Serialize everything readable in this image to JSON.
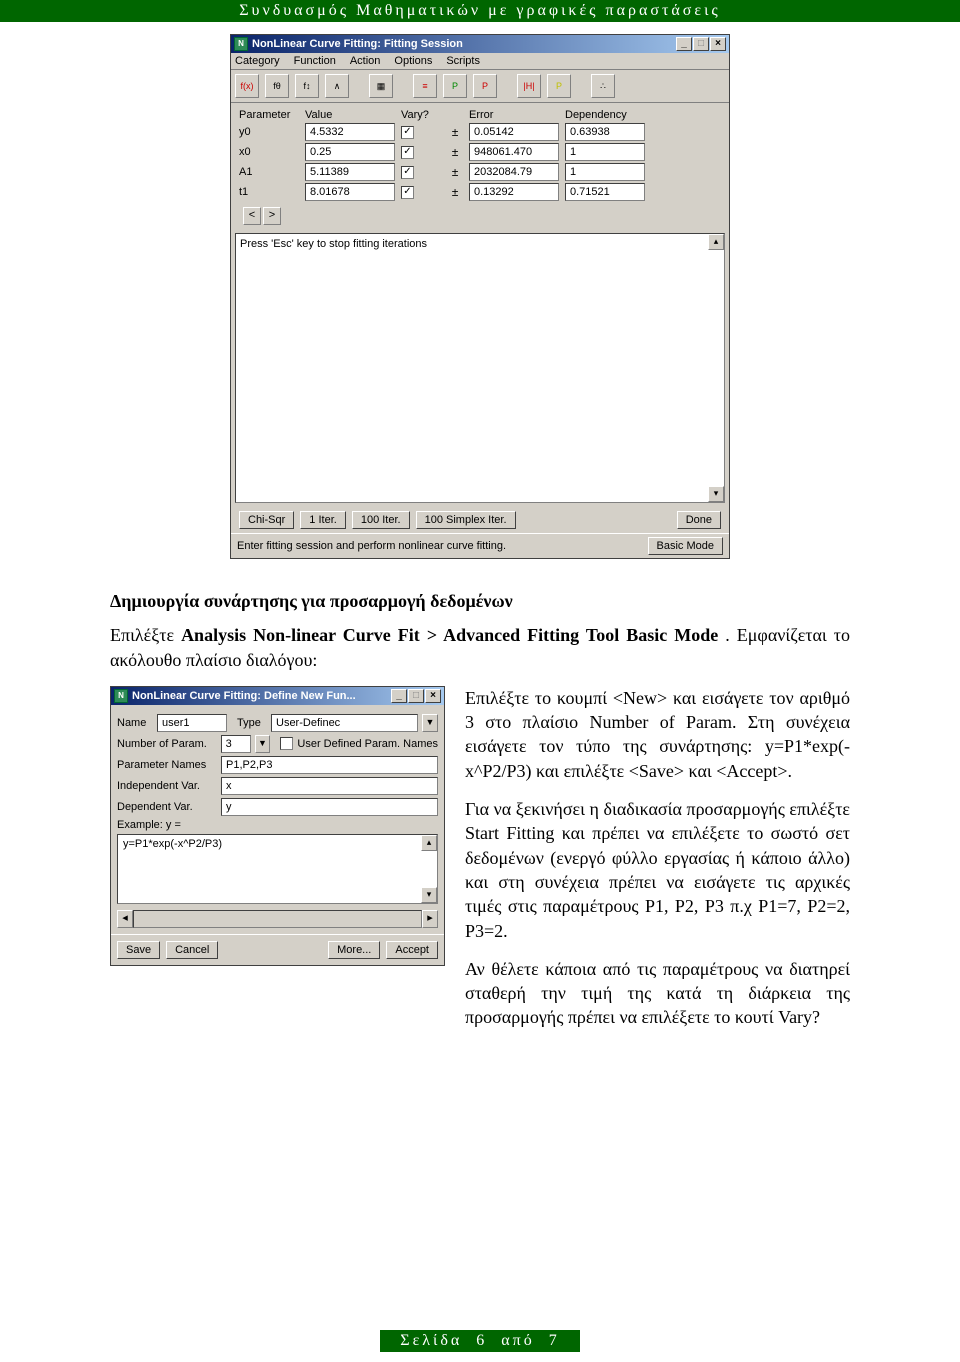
{
  "header_bar": "Συνδυασμός Μαθηματικών με γραφικές παραστάσεις",
  "dialog1": {
    "title": "NonLinear Curve Fitting: Fitting Session",
    "menu": [
      "Category",
      "Function",
      "Action",
      "Options",
      "Scripts"
    ],
    "toolbar_icons": [
      "f(x)",
      "fθ",
      "f↕",
      "∧",
      "▦",
      "≡",
      "P",
      "P",
      "|H|",
      "P",
      "∴"
    ],
    "columns": [
      "Parameter",
      "Value",
      "Vary?",
      "Error",
      "Dependency"
    ],
    "rows": [
      {
        "param": "y0",
        "value": "4.5332",
        "vary": true,
        "error": "0.05142",
        "dep": "0.63938"
      },
      {
        "param": "x0",
        "value": "0.25",
        "vary": true,
        "error": "948061.470",
        "dep": "1"
      },
      {
        "param": "A1",
        "value": "5.11389",
        "vary": true,
        "error": "2032084.79",
        "dep": "1"
      },
      {
        "param": "t1",
        "value": "8.01678",
        "vary": true,
        "error": "0.13292",
        "dep": "0.71521"
      }
    ],
    "log_text": "Press 'Esc' key to stop fitting iterations",
    "bottom_buttons": [
      "Chi-Sqr",
      "1 Iter.",
      "100 Iter.",
      "100 Simplex Iter."
    ],
    "done_btn": "Done",
    "status_text": "Enter fitting session and perform nonlinear curve fitting.",
    "mode_btn": "Basic Mode"
  },
  "doc": {
    "h3": "Δημιουργία συνάρτησης για προσαρμογή δεδομένων",
    "p1_a": "Επιλέξτε ",
    "p1_b": "Analysis Non-linear Curve Fit > Advanced Fitting Tool Basic Mode",
    "p1_c": ". Εμφανίζεται το ακόλουθο πλαίσιο διαλόγου:",
    "r1": "Επιλέξτε το κουμπί <New> και εισάγετε τον αριθμό 3 στο πλαίσιο Number of Param. Στη συνέχεια εισάγετε τον τύπο της συνάρτησης: y=P1*exp(-x^P2/P3) και επιλέξτε <Save> και <Accept>.",
    "r2": "Για να ξεκινήσει η διαδικασία προσαρμογής επιλέξτε Start Fitting και πρέπει να επιλέξετε το σωστό σετ δεδομένων (ενεργό φύλλο εργασίας ή κάποιο άλλο) και στη συνέχεια πρέπει να εισάγετε τις αρχικές τιμές στις παραμέτρους P1, P2, P3 π.χ P1=7, P2=2, P3=2.",
    "r3": "Αν θέλετε κάποια από τις παραμέτρους να διατηρεί σταθερή την τιμή της κατά τη διάρκεια της προσαρμογής πρέπει να επιλέξετε το κουτί Vary?"
  },
  "dialog2": {
    "title": "NonLinear Curve Fitting:  Define New Fun...",
    "name_label": "Name",
    "name_value": "user1",
    "type_label": "Type",
    "type_value": "User-Definec",
    "numparam_label": "Number of Param.",
    "numparam_value": "3",
    "userdef_label": "User Defined Param. Names",
    "paramnames_label": "Parameter Names",
    "paramnames_value": "P1,P2,P3",
    "indep_label": "Independent Var.",
    "indep_value": "x",
    "dep_label": "Dependent Var.",
    "dep_value": "y",
    "example_label": "Example: y =",
    "example_text": "y=P1*exp(-x^P2/P3)",
    "btn_save": "Save",
    "btn_cancel": "Cancel",
    "btn_more": "More...",
    "btn_accept": "Accept"
  },
  "footer": {
    "label_a": "Σελίδα",
    "page": "6",
    "label_b": "από",
    "total": "7"
  }
}
